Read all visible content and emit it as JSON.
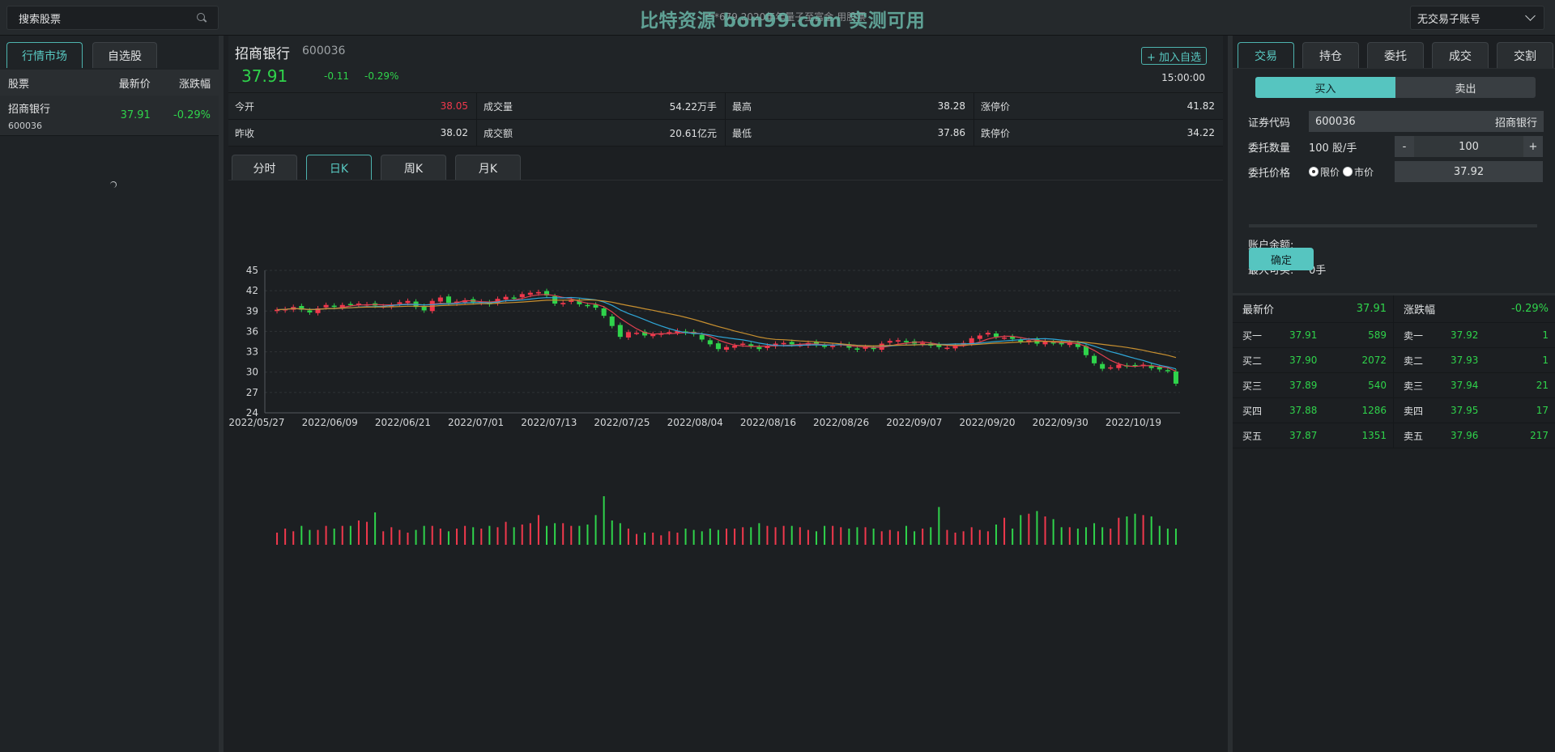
{
  "topbar": {
    "search_placeholder": "搜索股票",
    "watermark": "比特资源 bon99.com 实测可用",
    "broadcast": "***679 2020年年量子至富金 用股票",
    "account_label": "无交易子账号"
  },
  "left": {
    "tabs": [
      "行情市场",
      "自选股"
    ],
    "columns": [
      "股票",
      "最新价",
      "涨跌幅"
    ],
    "rows": [
      {
        "name": "招商银行",
        "code": "600036",
        "price": "37.91",
        "change": "-0.29%"
      }
    ]
  },
  "quote": {
    "name": "招商银行",
    "code": "600036",
    "price": "37.91",
    "change": "-0.11",
    "change_pct": "-0.29%",
    "add_fav": "+ 加入自选",
    "time": "15:00:00",
    "cells": [
      {
        "label": "今开",
        "value": "38.05",
        "color": "#f0384c"
      },
      {
        "label": "成交量",
        "value": "54.22万手"
      },
      {
        "label": "最高",
        "value": "38.28"
      },
      {
        "label": "涨停价",
        "value": "41.82"
      },
      {
        "label": "昨收",
        "value": "38.02"
      },
      {
        "label": "成交额",
        "value": "20.61亿元"
      },
      {
        "label": "最低",
        "value": "37.86"
      },
      {
        "label": "跌停价",
        "value": "34.22"
      }
    ]
  },
  "chart_tabs": [
    "分时",
    "日K",
    "周K",
    "月K"
  ],
  "chart_data": {
    "type": "candlestick",
    "ylim": [
      24,
      45
    ],
    "yticks": [
      45,
      42,
      39,
      36,
      33,
      30,
      27,
      24
    ],
    "xticks": [
      "2022/05/27",
      "2022/06/09",
      "2022/06/21",
      "2022/07/01",
      "2022/07/13",
      "2022/07/25",
      "2022/08/04",
      "2022/08/16",
      "2022/08/26",
      "2022/09/07",
      "2022/09/20",
      "2022/09/30",
      "2022/10/19"
    ],
    "close": [
      39.2,
      39.3,
      39.6,
      39.2,
      38.8,
      39.4,
      39.9,
      39.6,
      39.9,
      40.0,
      40.1,
      40.0,
      39.8,
      39.7,
      39.9,
      40.3,
      40.5,
      39.6,
      39.1,
      40.5,
      41.0,
      40.2,
      40.4,
      40.6,
      40.3,
      40.4,
      40.0,
      40.8,
      41.1,
      40.9,
      41.5,
      41.7,
      41.8,
      41.3,
      40.1,
      40.2,
      40.6,
      40.0,
      39.8,
      39.5,
      38.3,
      36.8,
      35.2,
      35.9,
      35.8,
      35.4,
      35.6,
      35.7,
      35.9,
      36.1,
      35.8,
      35.6,
      34.8,
      34.1,
      33.4,
      33.7,
      33.9,
      34.2,
      33.8,
      33.4,
      33.9,
      34.2,
      34.3,
      34.1,
      34.0,
      34.3,
      34.0,
      33.8,
      33.9,
      34.2,
      33.6,
      33.3,
      33.7,
      33.4,
      34.2,
      34.6,
      34.7,
      34.4,
      34.2,
      34.3,
      33.9,
      33.7,
      33.6,
      33.9,
      34.3,
      35.0,
      35.4,
      35.8,
      35.2,
      35.1,
      34.9,
      34.5,
      34.7,
      34.2,
      34.5,
      34.3,
      34.1,
      34.4,
      33.7,
      32.5,
      31.3,
      30.5,
      30.7,
      31.1,
      30.9,
      31.0,
      31.1,
      30.6,
      30.4,
      30.2,
      28.3
    ],
    "volume": [
      9,
      12,
      10,
      14,
      11,
      11,
      14,
      12,
      14,
      14,
      18,
      17,
      24,
      10,
      13,
      11,
      9,
      11,
      14,
      14,
      12,
      10,
      12,
      14,
      13,
      12,
      14,
      13,
      17,
      13,
      15,
      16,
      22,
      14,
      16,
      16,
      14,
      14,
      15,
      22,
      36,
      18,
      16,
      12,
      8,
      9,
      9,
      7,
      10,
      9,
      12,
      11,
      10,
      12,
      11,
      12,
      12,
      13,
      13,
      16,
      14,
      13,
      14,
      14,
      13,
      11,
      10,
      14,
      14,
      13,
      12,
      13,
      13,
      12,
      10,
      11,
      10,
      14,
      10,
      12,
      13,
      28,
      11,
      9,
      10,
      13,
      11,
      10,
      15,
      20,
      12,
      22,
      23,
      25,
      21,
      19,
      13,
      13,
      12,
      13,
      16,
      13,
      12,
      20,
      21,
      23,
      22,
      21,
      14,
      12,
      12,
      14,
      16,
      21
    ]
  },
  "right": {
    "tabs": [
      "交易",
      "持仓",
      "委托",
      "成交",
      "交割"
    ],
    "buy": "买入",
    "sell": "卖出",
    "code_label": "证券代码",
    "code_value": "600036",
    "code_name": "招商银行",
    "qty_label": "委托数量",
    "qty_unit": "100 股/手",
    "qty_minus": "-",
    "qty_value": "100",
    "qty_plus": "+",
    "price_label": "委托价格",
    "limit_label": "限价",
    "market_label": "市价",
    "price_value": "37.92",
    "balance_label": "账户余额:",
    "max_label": "最大可买:",
    "max_value": "0手",
    "confirm": "确定"
  },
  "depth": {
    "head": {
      "left_label": "最新价",
      "left_value": "37.91",
      "right_label": "涨跌幅",
      "right_value": "-0.29%"
    },
    "rows": [
      {
        "bl": "买一",
        "bp": "37.91",
        "bv": "589",
        "sl": "卖一",
        "sp": "37.92",
        "sv": "1"
      },
      {
        "bl": "买二",
        "bp": "37.90",
        "bv": "2072",
        "sl": "卖二",
        "sp": "37.93",
        "sv": "1"
      },
      {
        "bl": "买三",
        "bp": "37.89",
        "bv": "540",
        "sl": "卖三",
        "sp": "37.94",
        "sv": "21"
      },
      {
        "bl": "买四",
        "bp": "37.88",
        "bv": "1286",
        "sl": "卖四",
        "sp": "37.95",
        "sv": "17"
      },
      {
        "bl": "买五",
        "bp": "37.87",
        "bv": "1351",
        "sl": "卖五",
        "sp": "37.96",
        "sv": "217"
      }
    ]
  }
}
